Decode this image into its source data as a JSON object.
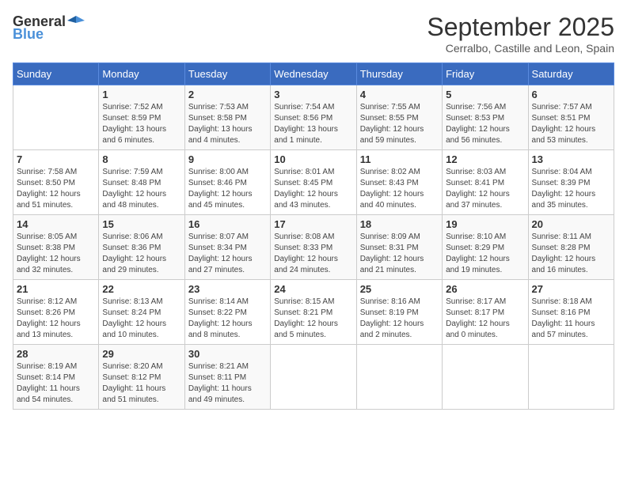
{
  "logo": {
    "text_general": "General",
    "text_blue": "Blue"
  },
  "title": "September 2025",
  "subtitle": "Cerralbo, Castille and Leon, Spain",
  "days_of_week": [
    "Sunday",
    "Monday",
    "Tuesday",
    "Wednesday",
    "Thursday",
    "Friday",
    "Saturday"
  ],
  "weeks": [
    [
      {
        "day": "",
        "info": ""
      },
      {
        "day": "1",
        "info": "Sunrise: 7:52 AM\nSunset: 8:59 PM\nDaylight: 13 hours\nand 6 minutes."
      },
      {
        "day": "2",
        "info": "Sunrise: 7:53 AM\nSunset: 8:58 PM\nDaylight: 13 hours\nand 4 minutes."
      },
      {
        "day": "3",
        "info": "Sunrise: 7:54 AM\nSunset: 8:56 PM\nDaylight: 13 hours\nand 1 minute."
      },
      {
        "day": "4",
        "info": "Sunrise: 7:55 AM\nSunset: 8:55 PM\nDaylight: 12 hours\nand 59 minutes."
      },
      {
        "day": "5",
        "info": "Sunrise: 7:56 AM\nSunset: 8:53 PM\nDaylight: 12 hours\nand 56 minutes."
      },
      {
        "day": "6",
        "info": "Sunrise: 7:57 AM\nSunset: 8:51 PM\nDaylight: 12 hours\nand 53 minutes."
      }
    ],
    [
      {
        "day": "7",
        "info": "Sunrise: 7:58 AM\nSunset: 8:50 PM\nDaylight: 12 hours\nand 51 minutes."
      },
      {
        "day": "8",
        "info": "Sunrise: 7:59 AM\nSunset: 8:48 PM\nDaylight: 12 hours\nand 48 minutes."
      },
      {
        "day": "9",
        "info": "Sunrise: 8:00 AM\nSunset: 8:46 PM\nDaylight: 12 hours\nand 45 minutes."
      },
      {
        "day": "10",
        "info": "Sunrise: 8:01 AM\nSunset: 8:45 PM\nDaylight: 12 hours\nand 43 minutes."
      },
      {
        "day": "11",
        "info": "Sunrise: 8:02 AM\nSunset: 8:43 PM\nDaylight: 12 hours\nand 40 minutes."
      },
      {
        "day": "12",
        "info": "Sunrise: 8:03 AM\nSunset: 8:41 PM\nDaylight: 12 hours\nand 37 minutes."
      },
      {
        "day": "13",
        "info": "Sunrise: 8:04 AM\nSunset: 8:39 PM\nDaylight: 12 hours\nand 35 minutes."
      }
    ],
    [
      {
        "day": "14",
        "info": "Sunrise: 8:05 AM\nSunset: 8:38 PM\nDaylight: 12 hours\nand 32 minutes."
      },
      {
        "day": "15",
        "info": "Sunrise: 8:06 AM\nSunset: 8:36 PM\nDaylight: 12 hours\nand 29 minutes."
      },
      {
        "day": "16",
        "info": "Sunrise: 8:07 AM\nSunset: 8:34 PM\nDaylight: 12 hours\nand 27 minutes."
      },
      {
        "day": "17",
        "info": "Sunrise: 8:08 AM\nSunset: 8:33 PM\nDaylight: 12 hours\nand 24 minutes."
      },
      {
        "day": "18",
        "info": "Sunrise: 8:09 AM\nSunset: 8:31 PM\nDaylight: 12 hours\nand 21 minutes."
      },
      {
        "day": "19",
        "info": "Sunrise: 8:10 AM\nSunset: 8:29 PM\nDaylight: 12 hours\nand 19 minutes."
      },
      {
        "day": "20",
        "info": "Sunrise: 8:11 AM\nSunset: 8:28 PM\nDaylight: 12 hours\nand 16 minutes."
      }
    ],
    [
      {
        "day": "21",
        "info": "Sunrise: 8:12 AM\nSunset: 8:26 PM\nDaylight: 12 hours\nand 13 minutes."
      },
      {
        "day": "22",
        "info": "Sunrise: 8:13 AM\nSunset: 8:24 PM\nDaylight: 12 hours\nand 10 minutes."
      },
      {
        "day": "23",
        "info": "Sunrise: 8:14 AM\nSunset: 8:22 PM\nDaylight: 12 hours\nand 8 minutes."
      },
      {
        "day": "24",
        "info": "Sunrise: 8:15 AM\nSunset: 8:21 PM\nDaylight: 12 hours\nand 5 minutes."
      },
      {
        "day": "25",
        "info": "Sunrise: 8:16 AM\nSunset: 8:19 PM\nDaylight: 12 hours\nand 2 minutes."
      },
      {
        "day": "26",
        "info": "Sunrise: 8:17 AM\nSunset: 8:17 PM\nDaylight: 12 hours\nand 0 minutes."
      },
      {
        "day": "27",
        "info": "Sunrise: 8:18 AM\nSunset: 8:16 PM\nDaylight: 11 hours\nand 57 minutes."
      }
    ],
    [
      {
        "day": "28",
        "info": "Sunrise: 8:19 AM\nSunset: 8:14 PM\nDaylight: 11 hours\nand 54 minutes."
      },
      {
        "day": "29",
        "info": "Sunrise: 8:20 AM\nSunset: 8:12 PM\nDaylight: 11 hours\nand 51 minutes."
      },
      {
        "day": "30",
        "info": "Sunrise: 8:21 AM\nSunset: 8:11 PM\nDaylight: 11 hours\nand 49 minutes."
      },
      {
        "day": "",
        "info": ""
      },
      {
        "day": "",
        "info": ""
      },
      {
        "day": "",
        "info": ""
      },
      {
        "day": "",
        "info": ""
      }
    ]
  ]
}
